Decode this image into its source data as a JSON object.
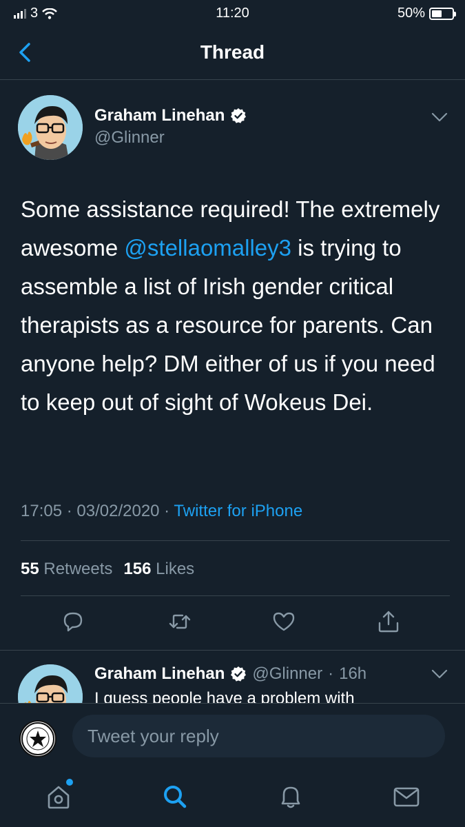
{
  "status_bar": {
    "carrier": "3",
    "time": "11:20",
    "battery_percent": "50%",
    "battery_level": 0.5
  },
  "nav": {
    "title": "Thread",
    "back_icon": "chevron-left-icon"
  },
  "tweet": {
    "author_name": "Graham Linehan",
    "author_handle": "@Glinner",
    "verified": true,
    "text_before": "Some assistance required! The extremely awesome ",
    "mention": "@stellaomalley3",
    "text_after": " is trying to assemble a list of Irish gender critical therapists as a resource for parents. Can anyone help? DM either of us if you need to keep out of sight of Wokeus Dei.",
    "time": "17:05",
    "date": "03/02/2020",
    "source": "Twitter for iPhone",
    "retweets_count": "55",
    "retweets_label": "Retweets",
    "likes_count": "156",
    "likes_label": "Likes"
  },
  "actions": [
    "reply-icon",
    "retweet-icon",
    "like-icon",
    "share-icon"
  ],
  "reply": {
    "author_name": "Graham Linehan",
    "author_handle": "@Glinner",
    "age": "16h",
    "text": "I guess people have a problem with"
  },
  "reply_bar": {
    "placeholder": "Tweet your reply"
  },
  "tab_bar": {
    "items": [
      "home-icon",
      "search-icon",
      "notifications-icon",
      "messages-icon"
    ],
    "active": "search-icon"
  },
  "colors": {
    "background": "#15202b",
    "accent": "#1da1f2",
    "muted": "#8899a6",
    "divider": "#38444d"
  }
}
